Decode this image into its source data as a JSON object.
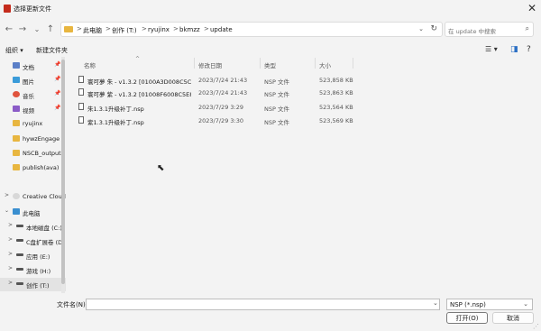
{
  "window": {
    "title": "选择更新文件",
    "close_glyph": "✕"
  },
  "nav": {
    "back_glyph": "←",
    "forward_glyph": "→",
    "recent_glyph": "⌄",
    "up_glyph": "↑"
  },
  "address": {
    "crumbs": [
      "此电脑",
      "创作 (T:)",
      "ryujinx",
      "bkmzz",
      "update"
    ],
    "separator": ">",
    "dropdown_glyph": "⌄",
    "refresh_glyph": "↻"
  },
  "search": {
    "placeholder": "在 update 中搜索",
    "icon": "search-icon"
  },
  "toolbar": {
    "organize_label": "组织 ▾",
    "new_folder_label": "新建文件夹",
    "view_glyph": "☰ ▾",
    "pane_glyph": "◨",
    "help_glyph": "?"
  },
  "sidebar": {
    "items": [
      {
        "label": "文档",
        "icon": "documents-icon",
        "color": "#5b7fc7",
        "pin": "📌"
      },
      {
        "label": "图片",
        "icon": "pictures-icon",
        "color": "#3a9bd9",
        "pin": "📌"
      },
      {
        "label": "音乐",
        "icon": "music-icon",
        "color": "#e0533d",
        "pin": "📌"
      },
      {
        "label": "视频",
        "icon": "videos-icon",
        "color": "#8b5cc7",
        "pin": "📌"
      },
      {
        "label": "ryujinx",
        "icon": "folder-icon",
        "color": "#e8b640",
        "pin": ""
      },
      {
        "label": "hywzEngage",
        "icon": "folder-icon",
        "color": "#e8b640",
        "pin": ""
      },
      {
        "label": "NSCB_output",
        "icon": "folder-icon",
        "color": "#e8b640",
        "pin": ""
      },
      {
        "label": "publish(ava)",
        "icon": "folder-icon",
        "color": "#e8b640",
        "pin": ""
      },
      {
        "label": "Creative Cloud",
        "icon": "creative-cloud-icon",
        "color": "#d8d8d8",
        "chevron": ">"
      },
      {
        "label": "此电脑",
        "icon": "this-pc-icon",
        "color": "#3a8fd0",
        "chevron": "⌄"
      },
      {
        "label": "本地磁盘 (C:)",
        "icon": "drive-icon",
        "color": "#555555",
        "chevron": ">"
      },
      {
        "label": "C盘扩展卷 (D:",
        "icon": "drive-icon",
        "color": "#555555",
        "chevron": ">"
      },
      {
        "label": "应用 (E:)",
        "icon": "drive-icon",
        "color": "#555555",
        "chevron": ">"
      },
      {
        "label": "游戏 (H:)",
        "icon": "drive-icon",
        "color": "#555555",
        "chevron": ">"
      },
      {
        "label": "创作 (T:)",
        "icon": "drive-icon",
        "color": "#555555",
        "chevron": ">",
        "selected": true
      }
    ]
  },
  "table": {
    "columns": [
      "名称",
      "修改日期",
      "类型",
      "大小"
    ],
    "sort_glyph": "^",
    "rows": [
      {
        "name": "寰可夢 朱 - v1.3.2 [0100A3D008C5C80...",
        "date": "2023/7/24 21:43",
        "type": "NSP 文件",
        "size": "523,858 KB"
      },
      {
        "name": "寰可夢 紫 - v1.3.2 [01008F6008C5E80...",
        "date": "2023/7/24 21:43",
        "type": "NSP 文件",
        "size": "523,863 KB"
      },
      {
        "name": "朱1.3.1升级补丁.nsp",
        "date": "2023/7/29 3:29",
        "type": "NSP 文件",
        "size": "523,564 KB"
      },
      {
        "name": "紫1.3.1升级补丁.nsp",
        "date": "2023/7/29 3:30",
        "type": "NSP 文件",
        "size": "523,569 KB"
      }
    ]
  },
  "bottom": {
    "filename_label": "文件名(N):",
    "filename_value": "",
    "filter_value": "NSP (*.nsp)",
    "open_label": "打开(O)",
    "cancel_label": "取消",
    "dropdown_glyph": "⌄"
  },
  "colors": {
    "folder": "#e8b640",
    "accent": "#c42b1c"
  }
}
